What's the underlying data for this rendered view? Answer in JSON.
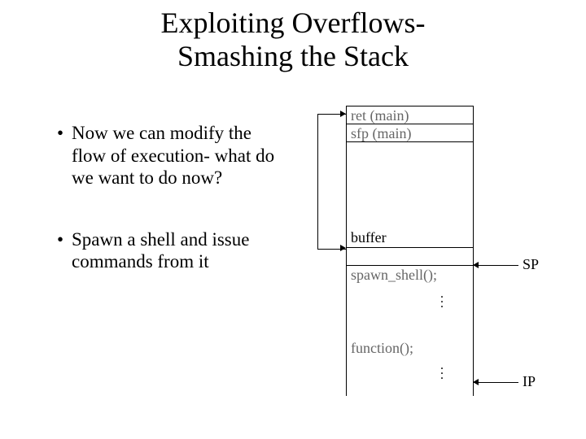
{
  "title_line1": "Exploiting Overflows-",
  "title_line2": "Smashing the Stack",
  "bullets": [
    "Now we can modify the flow of execution- what do we want to do now?",
    "Spawn a shell and issue commands from it"
  ],
  "stack": {
    "ret": "ret (main)",
    "sfp": "sfp (main)",
    "buffer": "buffer",
    "spawn": "spawn_shell();",
    "func": "function();"
  },
  "pointers": {
    "sp": "SP",
    "ip": "IP"
  }
}
